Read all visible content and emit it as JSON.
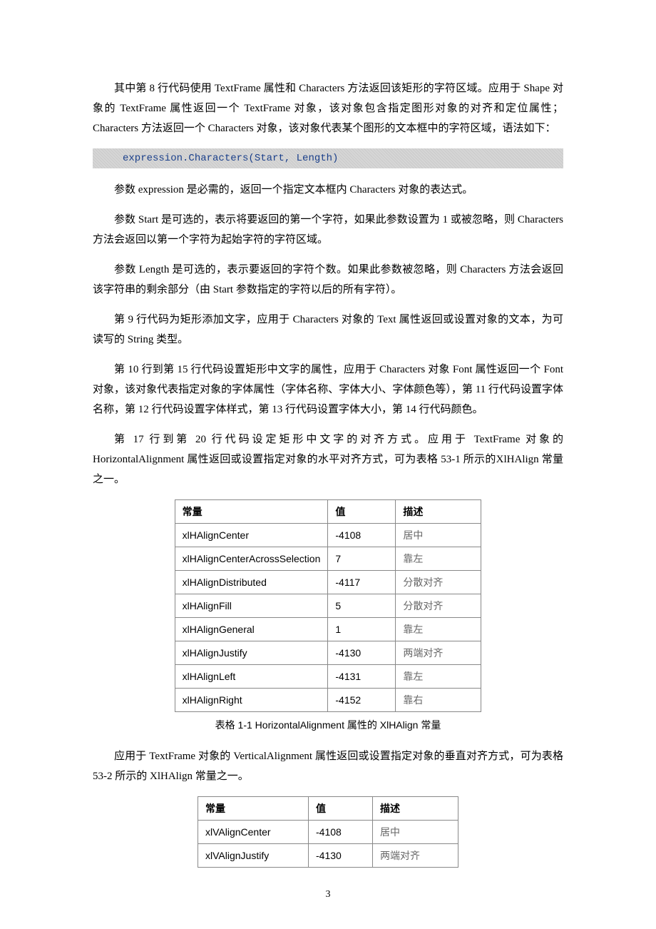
{
  "paragraphs": {
    "p1": "其中第 8 行代码使用 TextFrame 属性和 Characters 方法返回该矩形的字符区域。应用于 Shape 对象的 TextFrame 属性返回一个 TextFrame 对象，该对象包含指定图形对象的对齐和定位属性；Characters 方法返回一个 Characters 对象，该对象代表某个图形的文本框中的字符区域，语法如下：",
    "code1": "expression.Characters(Start, Length)",
    "p2": "参数 expression 是必需的，返回一个指定文本框内 Characters 对象的表达式。",
    "p3": "参数 Start 是可选的，表示将要返回的第一个字符，如果此参数设置为 1 或被忽略，则 Characters 方法会返回以第一个字符为起始字符的字符区域。",
    "p4": "参数 Length 是可选的，表示要返回的字符个数。如果此参数被忽略，则 Characters 方法会返回该字符串的剩余部分（由 Start 参数指定的字符以后的所有字符）。",
    "p5": "第 9 行代码为矩形添加文字，应用于 Characters 对象的 Text 属性返回或设置对象的文本，为可读写的 String 类型。",
    "p6": "第 10 行到第 15 行代码设置矩形中文字的属性，应用于 Characters 对象 Font 属性返回一个 Font 对象，该对象代表指定对象的字体属性（字体名称、字体大小、字体颜色等），第 11 行代码设置字体名称，第 12 行代码设置字体样式，第 13 行代码设置字体大小，第 14 行代码颜色。",
    "p7": "第 17 行到第 20 行代码设定矩形中文字的对齐方式。应用于 TextFrame 对象的HorizontalAlignment 属性返回或设置指定对象的水平对齐方式，可为表格 53-1 所示的XlHAlign 常量之一。",
    "p8": "应用于 TextFrame 对象的 VerticalAlignment 属性返回或设置指定对象的垂直对齐方式，可为表格 53-2 所示的 XlHAlign 常量之一。"
  },
  "table1": {
    "headers": [
      "常量",
      "值",
      "描述"
    ],
    "rows": [
      {
        "const": "xlHAlignCenter",
        "val": "-4108",
        "desc": "居中"
      },
      {
        "const": "xlHAlignCenterAcrossSelection",
        "val": "7",
        "desc": "靠左"
      },
      {
        "const": "xlHAlignDistributed",
        "val": "-4117",
        "desc": "分散对齐"
      },
      {
        "const": "xlHAlignFill",
        "val": "5",
        "desc": "分散对齐"
      },
      {
        "const": "xlHAlignGeneral",
        "val": "1",
        "desc": "靠左"
      },
      {
        "const": "xlHAlignJustify",
        "val": "-4130",
        "desc": "两端对齐"
      },
      {
        "const": "xlHAlignLeft",
        "val": "-4131",
        "desc": "靠左"
      },
      {
        "const": "xlHAlignRight",
        "val": "-4152",
        "desc": "靠右"
      }
    ],
    "caption": "表格 1-1 HorizontalAlignment 属性的 XlHAlign 常量"
  },
  "table2": {
    "headers": [
      "常量",
      "值",
      "描述"
    ],
    "rows": [
      {
        "const": "xlVAlignCenter",
        "val": "-4108",
        "desc": "居中"
      },
      {
        "const": "xlVAlignJustify",
        "val": "-4130",
        "desc": "两端对齐"
      }
    ]
  },
  "page_number": "3"
}
